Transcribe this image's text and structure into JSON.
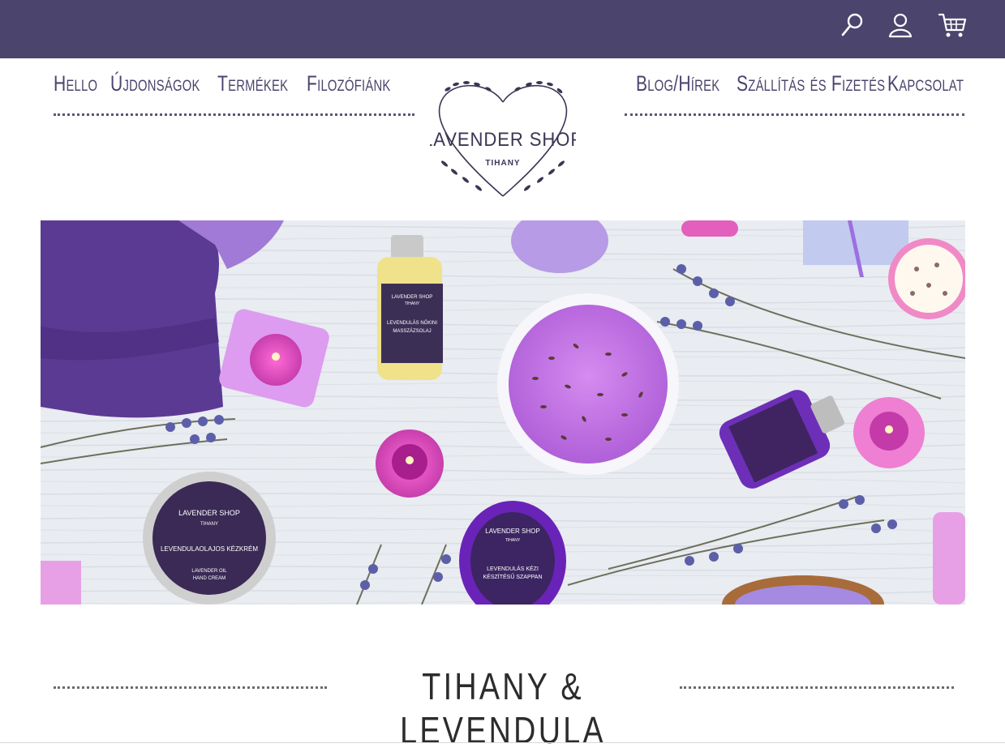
{
  "header": {
    "icons": [
      "search-icon",
      "user-icon",
      "cart-icon"
    ],
    "background_color": "#4b456d"
  },
  "nav": {
    "left": [
      {
        "label": "Hello"
      },
      {
        "label": "Újdonságok"
      },
      {
        "label": "Termékek"
      },
      {
        "label": "Filozófiánk"
      }
    ],
    "right": [
      {
        "label": "Blog/Hírek"
      },
      {
        "label": "Szállítás és Fizetés"
      },
      {
        "label": "Kapcsolat"
      }
    ]
  },
  "logo": {
    "title": "LAVENDER SHOP",
    "subtitle": "TIHANY"
  },
  "hero": {
    "products": [
      {
        "label_line1": "LAVENDER SHOP",
        "label_line2": "TIHANY",
        "label_line3": "LEVENDULÁS NŐKINI",
        "label_line4": "MASSZÁZSOLAJ"
      },
      {
        "label_line1": "LAVENDER SHOP",
        "label_line2": "TIHANY",
        "label_line3": "LEVENDULAOLAJOS KÉZKRÉM",
        "label_line4": "LAVENDER OIL",
        "label_line5": "HAND CREAM"
      },
      {
        "label_line1": "LAVENDER SHOP",
        "label_line2": "TIHANY",
        "label_line3": "LEVENDULÁS KÉZI",
        "label_line4": "KÉSZÍTÉSŰ SZAPPAN"
      }
    ]
  },
  "section": {
    "title": "TIHANY & LEVENDULA"
  },
  "colors": {
    "primary": "#4b456d",
    "lavender": "#9b6fc9",
    "pink": "#d85fc8"
  }
}
